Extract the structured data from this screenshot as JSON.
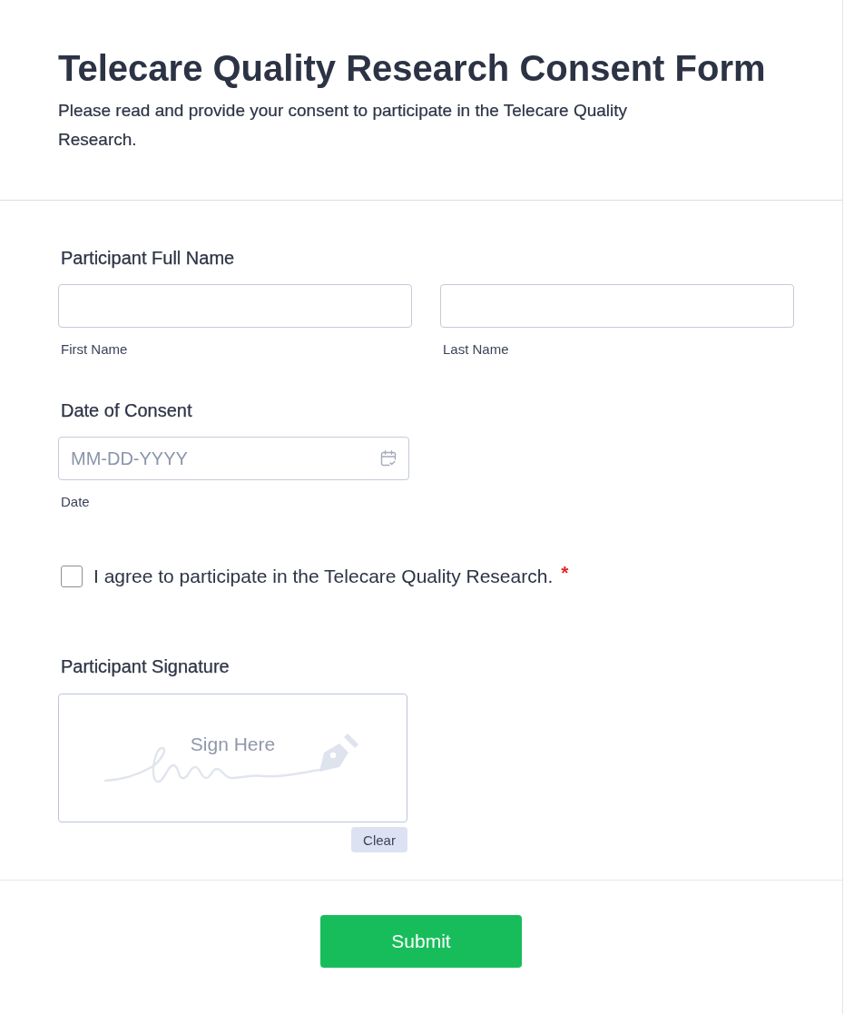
{
  "header": {
    "title": "Telecare Quality Research Consent Form",
    "description": "Please read and provide your consent to participate in the Telecare Quality Research."
  },
  "fields": [
    {
      "kind": "name",
      "label": "Participant Full Name",
      "inputs": [
        {
          "sublabel": "First Name"
        },
        {
          "sublabel": "Last Name"
        }
      ]
    },
    {
      "kind": "date",
      "label": "Date of Consent",
      "placeholder": "MM-DD-YYYY",
      "sublabel": "Date"
    },
    {
      "kind": "checkbox",
      "text": "I agree to participate in the Telecare Quality Research.",
      "checked": false,
      "required_mark": "*"
    },
    {
      "kind": "signature",
      "label": "Participant Signature",
      "prompt": "Sign Here",
      "clear_button": "Clear"
    }
  ],
  "submit": {
    "label": "Submit"
  }
}
